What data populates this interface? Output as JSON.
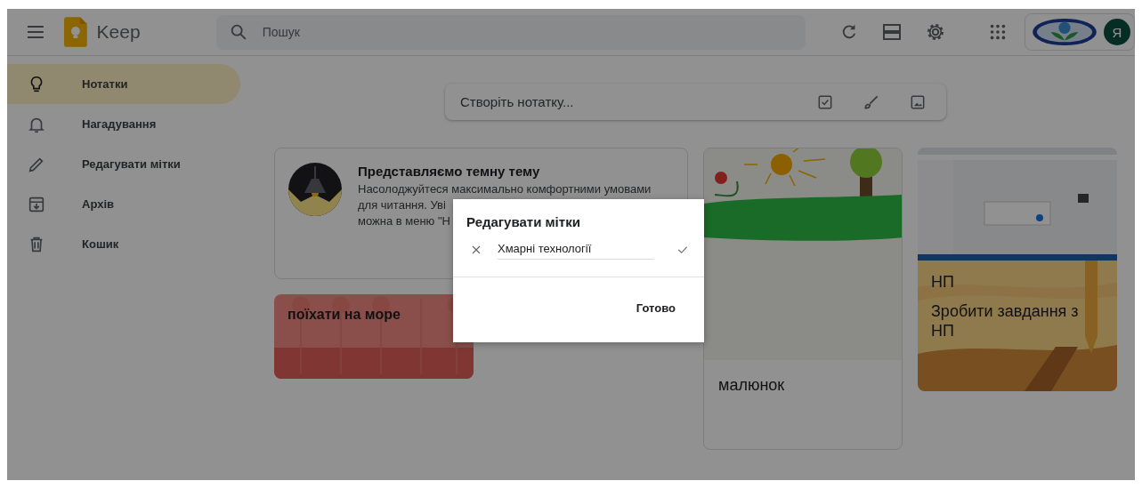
{
  "header": {
    "app_name": "Keep",
    "search": {
      "placeholder": "Пошук"
    },
    "avatar": "Я"
  },
  "sidebar": {
    "items": [
      {
        "label": "Нотатки",
        "kind": "bulb",
        "selected": true
      },
      {
        "label": "Нагадування",
        "kind": "bell",
        "selected": false
      },
      {
        "label": "Редагувати мітки",
        "kind": "pencil",
        "selected": false
      },
      {
        "label": "Архів",
        "kind": "archive",
        "selected": false
      },
      {
        "label": "Кошик",
        "kind": "trash",
        "selected": false
      }
    ]
  },
  "composer": {
    "placeholder": "Створіть нотатку..."
  },
  "notes": [
    {
      "kind": "promo",
      "title": "Представляємо темну тему",
      "lines": [
        "Насолоджуйтеся максимально комфортними умовами",
        "для читання. Уві",
        "можна в меню \"Н"
      ]
    },
    {
      "kind": "beach",
      "title": "поїхати на море"
    },
    {
      "kind": "drawing",
      "title": "малюнок"
    },
    {
      "kind": "desert",
      "heading": "НП",
      "title": "Зробити завдання з НП"
    }
  ],
  "dialog": {
    "title": "Редагувати мітки",
    "label_value": "Хмарні технології",
    "done": "Готово"
  }
}
